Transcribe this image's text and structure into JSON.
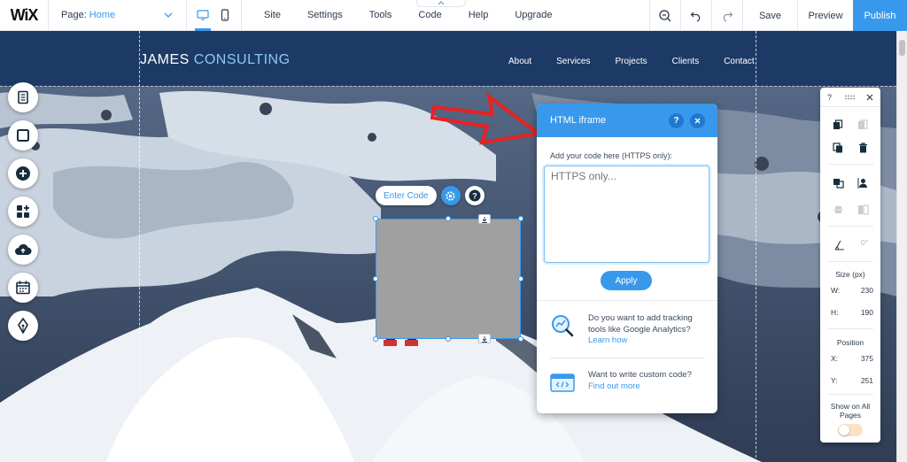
{
  "editor": {
    "logo": "WiX",
    "page_label": "Page:",
    "page_value": "Home",
    "menu": [
      "Site",
      "Settings",
      "Tools",
      "Code",
      "Help",
      "Upgrade"
    ],
    "save": "Save",
    "preview": "Preview",
    "publish": "Publish"
  },
  "site": {
    "title_main": "JAMES",
    "title_accent": "CONSULTING",
    "nav": [
      "About",
      "Services",
      "Projects",
      "Clients",
      "Contact"
    ]
  },
  "element": {
    "enter_code": "Enter Code"
  },
  "panel": {
    "title": "HTML iframe",
    "help": "?",
    "label": "Add your code here (HTTPS only):",
    "placeholder": "HTTPS only...",
    "apply": "Apply",
    "tip1_text": "Do you want to add tracking tools like Google Analytics?",
    "tip1_link": "Learn how",
    "tip2_text": "Want to write custom code?",
    "tip2_link": "Find out more"
  },
  "inspector": {
    "help": "?",
    "rotation": "0°",
    "size_label": "Size (px)",
    "w_label": "W:",
    "w_value": "230",
    "h_label": "H:",
    "h_value": "190",
    "position_label": "Position",
    "x_label": "X:",
    "x_value": "375",
    "y_label": "Y:",
    "y_value": "251",
    "show_all": "Show on All Pages"
  },
  "colors": {
    "accent": "#3899ec",
    "header": "#1d3a66",
    "arrow": "#e62222"
  }
}
